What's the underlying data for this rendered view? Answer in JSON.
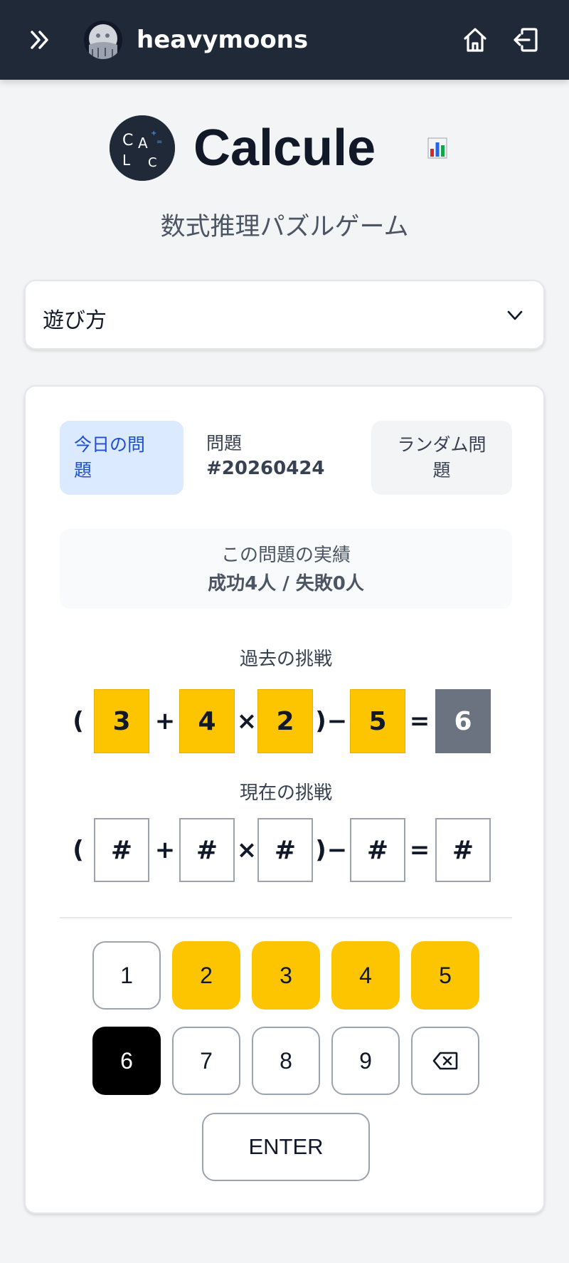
{
  "topbar": {
    "username": "heavymoons"
  },
  "header": {
    "title": "Calcule",
    "subtitle": "数式推理パズルゲーム",
    "logo_letters": [
      "C",
      "A",
      "L",
      "C"
    ]
  },
  "howto": {
    "label": "遊び方"
  },
  "tabs": {
    "today_line1": "今日の問",
    "today_line2": "題",
    "problem_label": "問題",
    "problem_number": "#20260424",
    "random_line1": "ランダム問",
    "random_line2": "題"
  },
  "record": {
    "title": "この問題の実績",
    "stats": "成功4人 / 失敗0人"
  },
  "past": {
    "label": "過去の挑戦",
    "paren_open": "(",
    "n1": "3",
    "op1": "+",
    "n2": "4",
    "op2": "×",
    "n3": "2",
    "paren_close": ")",
    "op3": "−",
    "n4": "5",
    "eq": "=",
    "result": "6"
  },
  "current": {
    "label": "現在の挑戦",
    "paren_open": "(",
    "n1": "#",
    "op1": "+",
    "n2": "#",
    "op2": "×",
    "n3": "#",
    "paren_close": ")",
    "op3": "−",
    "n4": "#",
    "eq": "=",
    "result": "#"
  },
  "keypad": {
    "k1": "1",
    "k2": "2",
    "k3": "3",
    "k4": "4",
    "k5": "5",
    "k6": "6",
    "k7": "7",
    "k8": "8",
    "k9": "9",
    "enter": "ENTER"
  },
  "colors": {
    "topbar": "#1f2937",
    "tile_yellow": "#fcc500",
    "tile_gray": "#6b7280",
    "tab_active_bg": "#dbeafe",
    "tab_active_text": "#1d4ed8"
  }
}
